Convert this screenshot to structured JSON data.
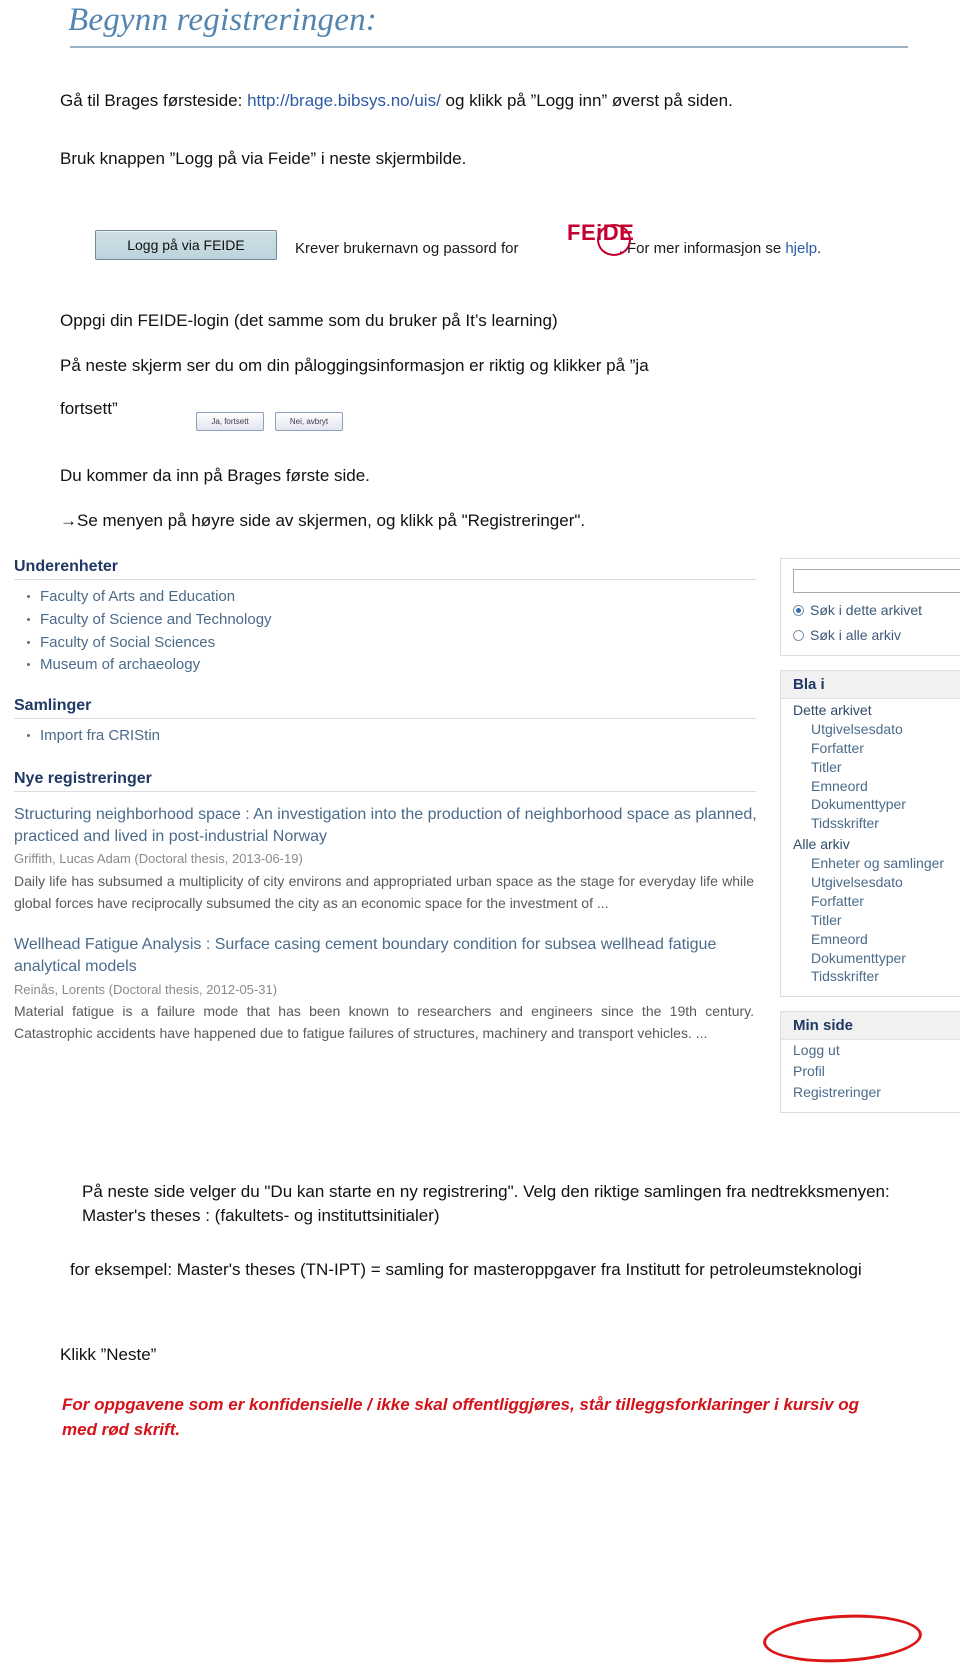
{
  "document": {
    "title": "Begynn registreringen:",
    "paragraphs": {
      "p1_a": "Gå til Brages førsteside: ",
      "p1_link": "http://brage.bibsys.no/uis/",
      "p1_b": " og klikk på ”Logg inn” øverst på siden.",
      "p2": "Bruk knappen ”Logg på via Feide” i neste skjermbilde.",
      "p3": "Oppgi din FEIDE-login (det samme som du bruker på It’s learning)",
      "p4": "På neste skjerm ser du om din påloggingsinformasjon er riktig og klikker på ”ja",
      "p5": "fortsett”",
      "p6": "Du kommer da inn på Brages første side.",
      "p7": "→Se menyen på høyre side av skjermen, og klikk på \"Registreringer\".",
      "bottom1": "På neste side velger du \"Du kan starte en ny registrering\".  Velg den riktige samlingen fra nedtrekksmenyen:  Master's theses : (fakultets- og instituttsinitialer)",
      "bottom2": "for eksempel:  Master's theses (TN-IPT)  = samling for masteroppgaver fra Institutt for petroleumsteknologi",
      "bottom3": "Klikk ”Neste”",
      "bottom4": "For oppgavene som er konfidensielle / ikke skal offentliggjøres, står tilleggsforklaringer i kursiv og med rød skrift."
    },
    "colors": {
      "title": "#5286b0",
      "link": "#2c5ba6",
      "warning": "#d4121a",
      "feide_red": "#c3002f",
      "brage_heading": "#1f3864",
      "brage_link": "#4a6b8a",
      "annotation_circle": "#dc1616"
    }
  },
  "feide_screenshot": {
    "button_label": "Logg på via FEIDE",
    "text_before": "Krever brukernavn og passord for",
    "logo_text": "FEiDE",
    "text_after": ". For mer informasjon se ",
    "help_link": "hjelp",
    "text_end": "."
  },
  "confirm_buttons": {
    "yes": "Ja, fortsett",
    "no": "Nei, avbryt"
  },
  "brage_screenshot": {
    "sections": [
      {
        "heading": "Underenheter",
        "items": [
          "Faculty of Arts and Education",
          "Faculty of Science and Technology",
          "Faculty of Social Sciences",
          "Museum of archaeology"
        ]
      },
      {
        "heading": "Samlinger",
        "items": [
          "Import fra CRIStin"
        ]
      }
    ],
    "new_registrations": {
      "heading": "Nye registreringer",
      "entries": [
        {
          "title": "Structuring neighborhood space : An investigation into the production of neighborhood space as planned, practiced and lived in post-industrial Norway",
          "meta": "Griffith, Lucas Adam (Doctoral thesis, 2013-06-19)",
          "abstract": "Daily life has subsumed a multiplicity of city environs and appropriated urban space as the stage for everyday life while global forces have reciprocally subsumed the city as an economic space for the investment of ..."
        },
        {
          "title": "Wellhead Fatigue Analysis : Surface casing cement boundary condition for subsea wellhead fatigue analytical models",
          "meta": "Reinås, Lorents (Doctoral thesis, 2012-05-31)",
          "abstract": "Material fatigue is a failure mode that has been known to researchers and engineers since the 19th century. Catastrophic accidents have happened due to fatigue failures of structures, machinery and transport vehicles. ..."
        }
      ]
    },
    "search_panel": {
      "input_value": "",
      "options": [
        {
          "label": "Søk i dette arkivet",
          "selected": true
        },
        {
          "label": "Søk i alle arkiv",
          "selected": false
        }
      ]
    },
    "browse_panel": {
      "heading": "Bla i",
      "groups": [
        {
          "label": "Dette arkivet",
          "items": [
            "Utgivelsesdato",
            "Forfatter",
            "Titler",
            "Emneord",
            "Dokumenttyper",
            "Tidsskrifter"
          ]
        },
        {
          "label": "Alle arkiv",
          "items": [
            "Enheter og samlinger",
            "Utgivelsesdato",
            "Forfatter",
            "Titler",
            "Emneord",
            "Dokumenttyper",
            "Tidsskrifter"
          ]
        }
      ]
    },
    "my_page_panel": {
      "heading": "Min side",
      "items": [
        "Logg ut",
        "Profil",
        "Registreringer"
      ]
    }
  }
}
